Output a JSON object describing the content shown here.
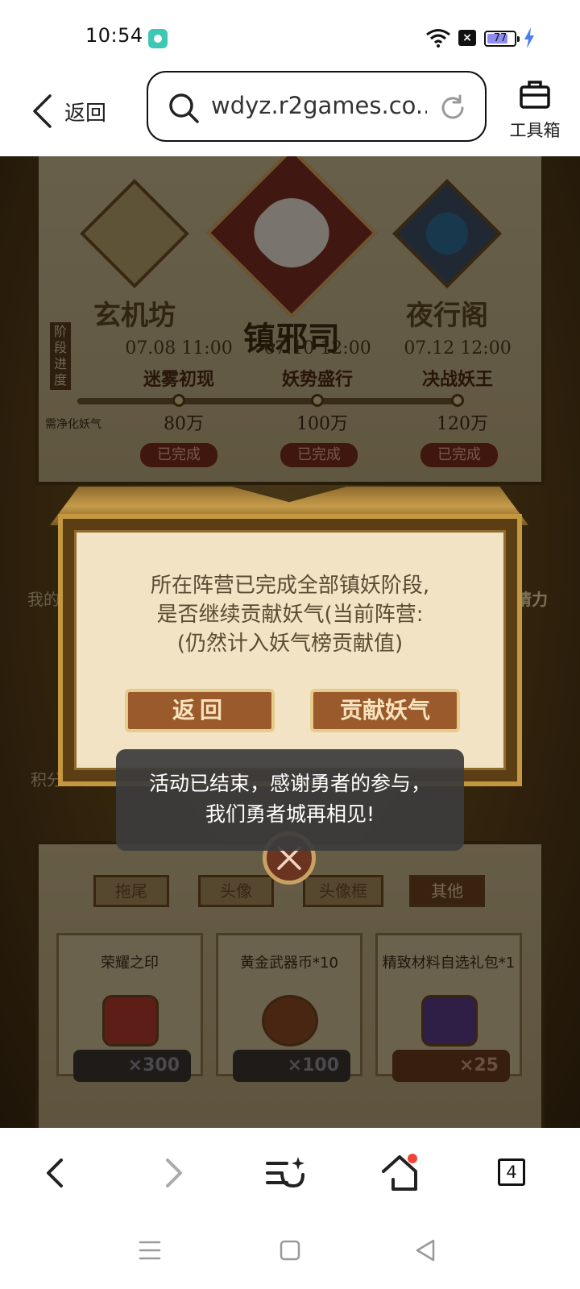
{
  "status_bar": {
    "time": "10:54",
    "battery_level": "77",
    "battery_fraction": 0.77,
    "icons": [
      "app-notification-icon",
      "wifi-icon",
      "x-notification-icon",
      "battery-icon",
      "charging-icon"
    ]
  },
  "browser": {
    "back_label": "返回",
    "url": "wdyz.r2games.co...",
    "toolbox_label": "工具箱"
  },
  "game": {
    "factions": [
      {
        "name": "玄机坊"
      },
      {
        "name": "镇邪司"
      },
      {
        "name": "夜行阁"
      }
    ],
    "stage_tag": "阶段进度",
    "stage_need_label": "需净化妖气",
    "stages": [
      {
        "date": "07.08 11:00",
        "name": "迷雾初现",
        "goal": "80万",
        "status": "已完成"
      },
      {
        "date": "07.10 12:00",
        "name": "妖势盛行",
        "goal": "100万",
        "status": "已完成"
      },
      {
        "date": "07.12 12:00",
        "name": "决战妖王",
        "goal": "120万",
        "status": "已完成"
      }
    ],
    "side_left_text": "我的",
    "side_left_text_2": "积分",
    "side_right_text": "请力",
    "tabs": [
      "拖尾",
      "头像",
      "头像框",
      "其他"
    ],
    "rewards": [
      {
        "name": "荣耀之印",
        "cost": "×300",
        "icon": "crown-icon"
      },
      {
        "name": "黄金武器币*10",
        "cost": "×100",
        "icon": "coin-chest-icon"
      },
      {
        "name": "精致材料自选礼包*1",
        "cost": "×25",
        "icon": "gift-pack-icon"
      }
    ],
    "modal": {
      "line1": "所在阵营已完成全部镇妖阶段,",
      "line2": "是否继续贡献妖气(当前阵营:",
      "line3": "(仍然计入妖气榜贡献值)",
      "back_button": "返回",
      "contribute_button": "贡献妖气"
    }
  },
  "toast": {
    "line1": "活动已结束，感谢勇者的参与，",
    "line2": "我们勇者城再相见!"
  },
  "bottom_nav": {
    "tab_count": "4",
    "icons": [
      "back-arrow-icon",
      "forward-arrow-icon",
      "menu-sparkle-icon",
      "home-icon",
      "tabs-icon"
    ]
  },
  "system_nav": {
    "icons": [
      "recent-apps-icon",
      "home-square-icon",
      "back-triangle-icon"
    ]
  }
}
